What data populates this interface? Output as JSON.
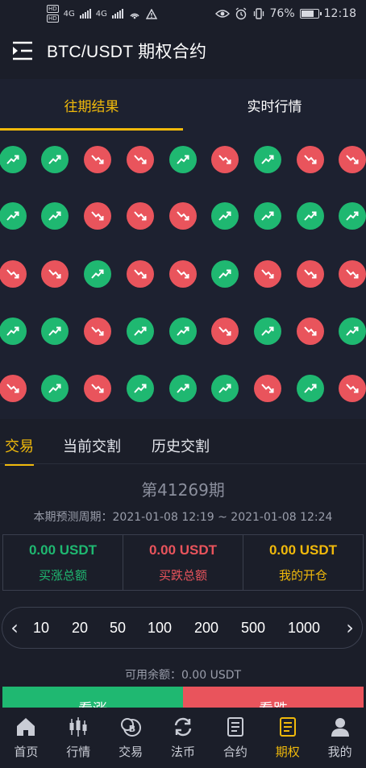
{
  "status_bar": {
    "net_label_1": "HD",
    "net_label_2": "HD",
    "net_type_1": "4G",
    "net_type_2": "4G",
    "battery_percent": "76%",
    "battery_level": 0.76,
    "time": "12:18"
  },
  "header": {
    "title": "BTC/USDT 期权合约",
    "menu_icon": "menu-collapse-icon"
  },
  "top_tabs": [
    {
      "label": "往期结果",
      "active": true
    },
    {
      "label": "实时行情",
      "active": false
    }
  ],
  "results": {
    "rows": [
      [
        "up",
        "up",
        "down",
        "down",
        "up",
        "down",
        "up",
        "down",
        "down"
      ],
      [
        "up",
        "up",
        "down",
        "down",
        "down",
        "up",
        "up",
        "up",
        "up"
      ],
      [
        "down",
        "down",
        "up",
        "down",
        "down",
        "up",
        "down",
        "down",
        "down"
      ],
      [
        "up",
        "up",
        "down",
        "up",
        "up",
        "down",
        "up",
        "down",
        "up"
      ],
      [
        "down",
        "up",
        "down",
        "up",
        "up",
        "up",
        "down",
        "up",
        "down"
      ]
    ],
    "up_color": "#1fb871",
    "down_color": "#e9545c"
  },
  "sub_tabs": [
    {
      "label": "交易",
      "active": true
    },
    {
      "label": "当前交割",
      "active": false
    },
    {
      "label": "历史交割",
      "active": false
    }
  ],
  "period": {
    "title": "第41269期",
    "range": "本期预测周期：2021-01-08 12:19 ~ 2021-01-08 12:24"
  },
  "stats": [
    {
      "value": "0.00 USDT",
      "label": "买涨总额",
      "color": "green"
    },
    {
      "value": "0.00 USDT",
      "label": "买跌总额",
      "color": "red"
    },
    {
      "value": "0.00 USDT",
      "label": "我的开仓",
      "color": "gold"
    }
  ],
  "amounts": {
    "options": [
      "10",
      "20",
      "50",
      "100",
      "200",
      "500",
      "1000"
    ]
  },
  "balance": "可用余额：0.00 USDT",
  "trade_buttons": {
    "up_label": "看涨",
    "down_label": "看跌"
  },
  "bottom_nav": [
    {
      "label": "首页",
      "icon": "home-icon",
      "active": false
    },
    {
      "label": "行情",
      "icon": "candlestick-icon",
      "active": false
    },
    {
      "label": "交易",
      "icon": "bitcoin-coins-icon",
      "active": false
    },
    {
      "label": "法币",
      "icon": "exchange-icon",
      "active": false
    },
    {
      "label": "合约",
      "icon": "contract-doc-icon",
      "active": false
    },
    {
      "label": "期权",
      "icon": "options-doc-icon",
      "active": true
    },
    {
      "label": "我的",
      "icon": "user-icon",
      "active": false
    }
  ],
  "colors": {
    "accent": "#f0b90b",
    "background": "#1b1e29",
    "panel": "#1d2130"
  }
}
